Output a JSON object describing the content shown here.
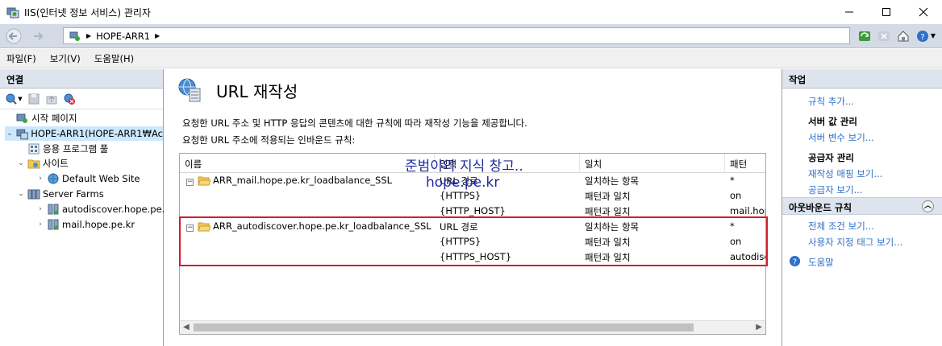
{
  "window": {
    "title": "IIS(인터넷 정보 서비스) 관리자"
  },
  "address": {
    "segments": [
      "HOPE-ARR1"
    ]
  },
  "menu": {
    "items": [
      "파일(F)",
      "보기(V)",
      "도움말(H)"
    ]
  },
  "connections": {
    "title": "연결",
    "tree": {
      "start_page": "시작 페이지",
      "server": "HOPE-ARR1(HOPE-ARR1₩Ac",
      "app_pools": "응용 프로그램 풀",
      "sites": "사이트",
      "default_site": "Default Web Site",
      "server_farms": "Server Farms",
      "farm1": "autodiscover.hope.pe.",
      "farm2": "mail.hope.pe.kr"
    }
  },
  "feature": {
    "title": "URL 재작성",
    "description": "요청한 URL 주소 및 HTTP 응답의 콘텐츠에 대한 규칙에 따라 재작성 기능을 제공합니다.",
    "list_caption": "요청한 URL 주소에 적용되는 인바운드 규칙:",
    "columns": [
      "이름",
      "입력",
      "일치",
      "패턴"
    ],
    "rules": [
      {
        "name": "ARR_mail.hope.pe.kr_loadbalance_SSL",
        "conditions": [
          {
            "input": "URL 경로",
            "match": "일치하는 항목",
            "pattern": "*"
          },
          {
            "input": "{HTTPS}",
            "match": "패턴과 일치",
            "pattern": "on"
          },
          {
            "input": "{HTTP_HOST}",
            "match": "패턴과 일치",
            "pattern": "mail.hop"
          }
        ]
      },
      {
        "name": "ARR_autodiscover.hope.pe.kr_loadbalance_SSL",
        "conditions": [
          {
            "input": "URL 경로",
            "match": "일치하는 항목",
            "pattern": "*"
          },
          {
            "input": "{HTTPS}",
            "match": "패턴과 일치",
            "pattern": "on"
          },
          {
            "input": "{HTTPS_HOST}",
            "match": "패턴과 일치",
            "pattern": "autodisc"
          }
        ]
      }
    ],
    "watermark": {
      "line1": "준범이의 지식 창고..",
      "line2": "hope.pe.kr"
    }
  },
  "actions": {
    "title": "작업",
    "add_rule": "규칙 추가...",
    "server_vars_section": "서버 값 관리",
    "view_server_vars": "서버 변수 보기...",
    "providers_section": "공급자 관리",
    "view_rewrite_maps": "재작성 매핑 보기...",
    "view_providers": "공급자 보기...",
    "outbound_section": "아웃바운드 규칙",
    "view_preconditions": "전제 조건 보기...",
    "view_custom_tags": "사용자 지정 태그 보기...",
    "help": "도움말"
  },
  "colors": {
    "highlight_box": "#d11f2b",
    "link": "#2d6ec7",
    "watermark": "#1f2b9e",
    "panel_header": "#dde4ee"
  }
}
